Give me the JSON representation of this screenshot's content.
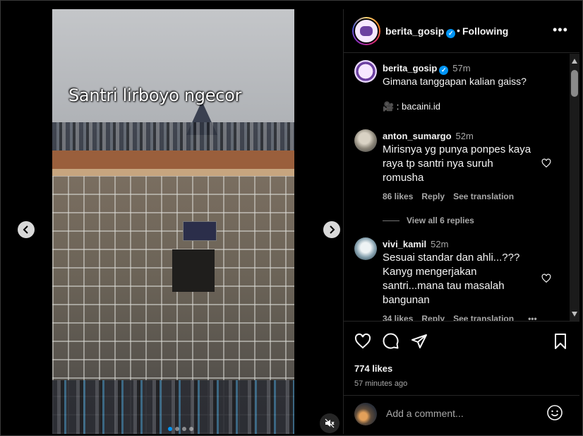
{
  "media": {
    "caption": "Santri lirboyo ngecor",
    "slide_count": 4,
    "active_slide": 1
  },
  "header": {
    "username": "berita_gosip",
    "separator": "•",
    "follow_status": "Following",
    "more_glyph": "•••"
  },
  "post": {
    "username": "berita_gosip",
    "time": "57m",
    "text": "Gimana tanggapan kalian gaiss?",
    "credit": "🎥 : bacaini.id"
  },
  "comments": [
    {
      "username": "anton_sumargo",
      "time": "52m",
      "text": "Mirisnya yg punya ponpes kaya raya tp santri nya suruh romusha",
      "likes": "86 likes",
      "reply": "Reply",
      "translate": "See translation",
      "view_replies": "View all 6 replies"
    },
    {
      "username": "vivi_kamil",
      "time": "52m",
      "text": "Sesuai standar dan ahli...??? Kanyg mengerjakan santri...mana tau masalah bangunan",
      "likes": "34 likes",
      "reply": "Reply",
      "translate": "See translation",
      "more": "•••"
    }
  ],
  "actions": {
    "likes": "774 likes",
    "time_ago": "57 minutes ago"
  },
  "add_comment": {
    "placeholder": "Add a comment..."
  },
  "colors": {
    "verified": "#0095f6",
    "active_dot": "#0095f6",
    "background": "#000000",
    "muted_text": "#a8a8a8"
  },
  "icons": [
    "chevron-left-icon",
    "chevron-right-icon",
    "mute-icon",
    "verified-icon",
    "more-icon",
    "heart-icon",
    "comment-icon",
    "share-icon",
    "bookmark-icon",
    "emoji-icon"
  ]
}
